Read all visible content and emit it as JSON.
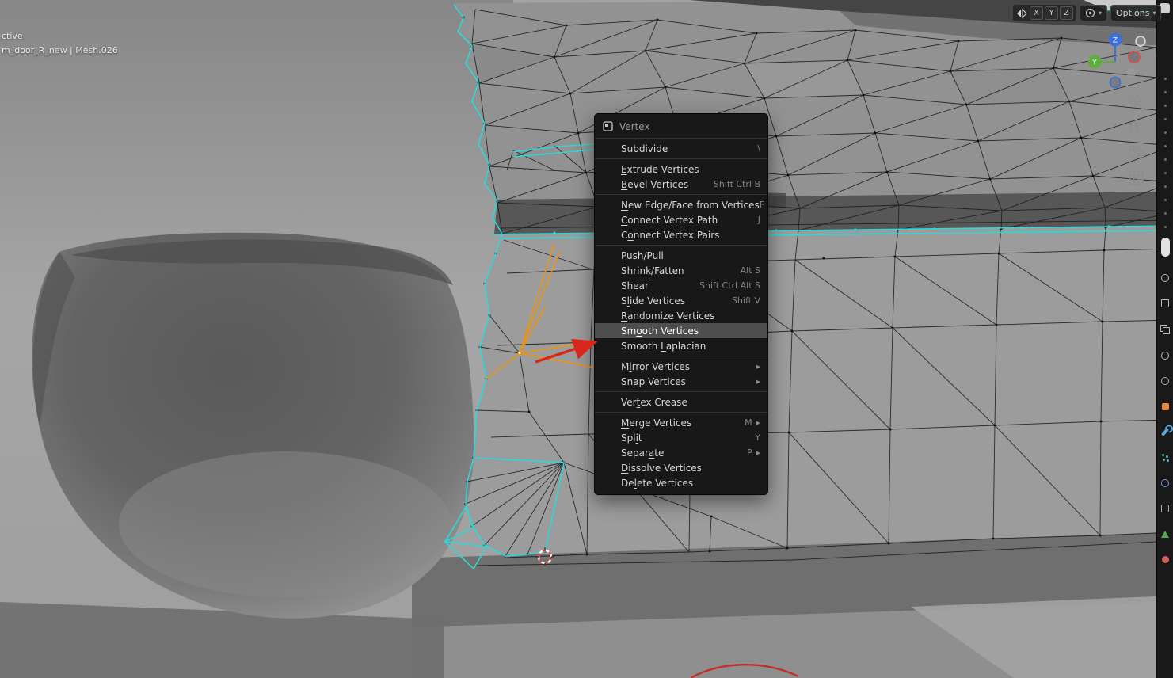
{
  "colors": {
    "selection_cyan": "#2dd8d8",
    "active_orange": "#f0930f",
    "annotation_red": "#d8281c",
    "menu_bg": "#181818",
    "menu_highlight": "#4e4e4e",
    "viewport_gray": "#a2a2a2"
  },
  "overlay_text": {
    "line1": "ctive",
    "line2": "m_door_R_new | Mesh.026"
  },
  "header": {
    "mirror_axes": [
      "X",
      "Y",
      "Z"
    ],
    "options_label": "Options",
    "caret": "▾"
  },
  "gizmo": {
    "z_label": "Z",
    "y_label": "Y"
  },
  "icons": {
    "nav": [
      "zoom-icon",
      "pan-hand-icon",
      "camera-view-icon",
      "grid-ortho-icon"
    ],
    "header": [
      "mirror-icon",
      "proportional-falloff-icon"
    ],
    "submenu_arrow": "▶"
  },
  "context_menu": {
    "title": "Vertex",
    "items": [
      {
        "label": "Subdivide",
        "shortcut": "\\",
        "u": 0
      },
      {
        "type": "sep"
      },
      {
        "label": "Extrude Vertices",
        "u": 0
      },
      {
        "label": "Bevel Vertices",
        "shortcut": "Shift Ctrl B",
        "u": 0
      },
      {
        "type": "sep"
      },
      {
        "label": "New Edge/Face from Vertices",
        "shortcut": "F",
        "u": 0
      },
      {
        "label": "Connect Vertex Path",
        "shortcut": "J",
        "u": 0
      },
      {
        "label": "Connect Vertex Pairs",
        "u": 1
      },
      {
        "type": "sep"
      },
      {
        "label": "Push/Pull",
        "u": 0
      },
      {
        "label": "Shrink/Fatten",
        "shortcut": "Alt S",
        "u": 7
      },
      {
        "label": "Shear",
        "shortcut": "Shift Ctrl Alt S",
        "u": 3
      },
      {
        "label": "Slide Vertices",
        "shortcut": "Shift V",
        "u": 1
      },
      {
        "label": "Randomize Vertices",
        "u": 0
      },
      {
        "label": "Smooth Vertices",
        "highlighted": true,
        "u": 2
      },
      {
        "label": "Smooth Laplacian",
        "u": 7
      },
      {
        "type": "sep"
      },
      {
        "label": "Mirror Vertices",
        "submenu": true,
        "u": 1
      },
      {
        "label": "Snap Vertices",
        "submenu": true,
        "u": 2
      },
      {
        "type": "sep"
      },
      {
        "label": "Vertex Crease",
        "u": 3
      },
      {
        "type": "sep"
      },
      {
        "label": "Merge Vertices",
        "shortcut": "M",
        "submenu": true,
        "u": 0
      },
      {
        "label": "Split",
        "shortcut": "Y",
        "u": 3
      },
      {
        "label": "Separate",
        "shortcut": "P",
        "submenu": true,
        "u": 5
      },
      {
        "label": "Dissolve Vertices",
        "u": 0
      },
      {
        "label": "Delete Vertices",
        "u": 2
      }
    ]
  },
  "sidebar": {
    "dots_count": 12,
    "tabs": [
      {
        "name": "tool-tab",
        "shape": "pill",
        "color": "#e2e2e2",
        "selected": true
      },
      {
        "name": "render-tab",
        "shape": "ring",
        "color": "#bdbdbd"
      },
      {
        "name": "output-tab",
        "shape": "square-outline",
        "color": "#bdbdbd"
      },
      {
        "name": "viewlayer-tab",
        "shape": "double-square",
        "color": "#bdbdbd"
      },
      {
        "name": "scene-tab",
        "shape": "ring",
        "color": "#bdbdbd"
      },
      {
        "name": "world-tab",
        "shape": "ring",
        "color": "#9fb6c6"
      },
      {
        "name": "object-tab",
        "shape": "square",
        "color": "#e8883a"
      },
      {
        "name": "modifier-tab",
        "shape": "wrench",
        "color": "#58a6e0"
      },
      {
        "name": "particles-tab",
        "shape": "dots",
        "color": "#4db8b8"
      },
      {
        "name": "physics-tab",
        "shape": "ring",
        "color": "#6f9fd8"
      },
      {
        "name": "constraints-tab",
        "shape": "square-outline",
        "color": "#b0b0b0"
      },
      {
        "name": "data-tab",
        "shape": "triangle",
        "color": "#53b04f"
      },
      {
        "name": "material-tab",
        "shape": "circle",
        "color": "#d4605a"
      }
    ]
  }
}
